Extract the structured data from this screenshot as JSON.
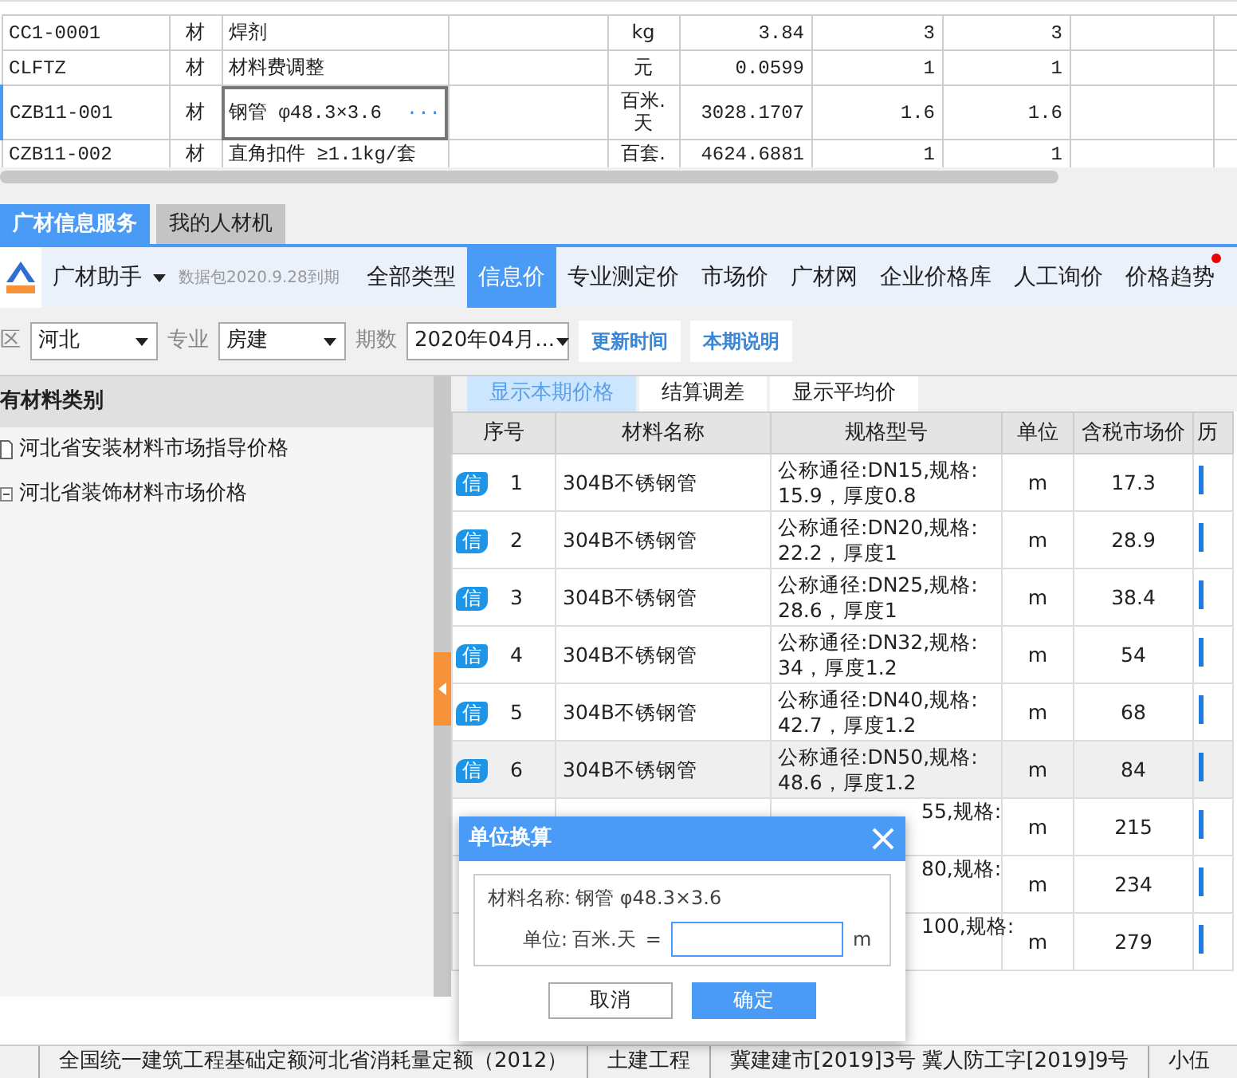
{
  "top_grid": {
    "rows": [
      {
        "code": "CC1-0001",
        "type": "材",
        "name": "焊剂",
        "unit": "kg",
        "price": "3.84",
        "qty_1": "3",
        "qty_2": "3",
        "selected": false
      },
      {
        "code": "CLFTZ",
        "type": "材",
        "name": "材料费调整",
        "unit": "元",
        "price": "0.0599",
        "qty_1": "1",
        "qty_2": "1",
        "selected": false
      },
      {
        "code": "CZB11-001",
        "type": "材",
        "name": "钢管 φ48.3×3.6",
        "unit": "百米.天",
        "price": "3028.1707",
        "qty_1": "1.6",
        "qty_2": "1.6",
        "selected": true,
        "more": "···"
      },
      {
        "code": "CZB11-002",
        "type": "材",
        "name": "直角扣件 ≥1.1kg/套",
        "unit": "百套.",
        "price": "4624.6881",
        "qty_1": "1",
        "qty_2": "1",
        "selected": false
      }
    ]
  },
  "panel_tabs": [
    {
      "label": "广材信息服务",
      "selected": true
    },
    {
      "label": "我的人材机",
      "selected": false
    }
  ],
  "toolbar": {
    "brand": "广材助手",
    "expiry": "数据包2020.9.28到期",
    "nav": [
      {
        "label": "全部类型",
        "selected": false,
        "notification": false
      },
      {
        "label": "信息价",
        "selected": true,
        "notification": false
      },
      {
        "label": "专业测定价",
        "selected": false,
        "notification": false
      },
      {
        "label": "市场价",
        "selected": false,
        "notification": false
      },
      {
        "label": "广材网",
        "selected": false,
        "notification": false
      },
      {
        "label": "企业价格库",
        "selected": false,
        "notification": false
      },
      {
        "label": "人工询价",
        "selected": false,
        "notification": false
      },
      {
        "label": "价格趋势",
        "selected": false,
        "notification": true
      }
    ]
  },
  "filters": {
    "region_label": "区",
    "region": "河北",
    "specialty_label": "专业",
    "specialty": "房建",
    "period_label": "期数",
    "period": "2020年04月...",
    "buttons": [
      "更新时间",
      "本期说明"
    ]
  },
  "category_panel": {
    "title": "有材料类别",
    "items": [
      {
        "label": "河北省安装材料市场指导价格",
        "kind": "file"
      },
      {
        "label": "河北省装饰材料市场价格",
        "kind": "expandable"
      }
    ]
  },
  "view_tabs": [
    {
      "label": "显示本期价格",
      "selected": true
    },
    {
      "label": "结算调差",
      "selected": false
    },
    {
      "label": "显示平均价",
      "selected": false
    }
  ],
  "price_table": {
    "columns": [
      "序号",
      "材料名称",
      "规格型号",
      "单位",
      "含税市场价",
      "历"
    ],
    "rows": [
      {
        "kind": "full",
        "badge": "信",
        "seq": "1",
        "name": "304B不锈钢管",
        "spec_lines": [
          "公称通径:DN15,规格:",
          "15.9，厚度0.8"
        ],
        "unit": "m",
        "price": "17.3",
        "selected": false
      },
      {
        "kind": "full",
        "badge": "信",
        "seq": "2",
        "name": "304B不锈钢管",
        "spec_lines": [
          "公称通径:DN20,规格:",
          "22.2，厚度1"
        ],
        "unit": "m",
        "price": "28.9",
        "selected": false
      },
      {
        "kind": "full",
        "badge": "信",
        "seq": "3",
        "name": "304B不锈钢管",
        "spec_lines": [
          "公称通径:DN25,规格:",
          "28.6，厚度1"
        ],
        "unit": "m",
        "price": "38.4",
        "selected": false
      },
      {
        "kind": "full",
        "badge": "信",
        "seq": "4",
        "name": "304B不锈钢管",
        "spec_lines": [
          "公称通径:DN32,规格:",
          "34，厚度1.2"
        ],
        "unit": "m",
        "price": "54",
        "selected": false
      },
      {
        "kind": "full",
        "badge": "信",
        "seq": "5",
        "name": "304B不锈钢管",
        "spec_lines": [
          "公称通径:DN40,规格:",
          "42.7，厚度1.2"
        ],
        "unit": "m",
        "price": "68",
        "selected": false
      },
      {
        "kind": "full",
        "badge": "信",
        "seq": "6",
        "name": "304B不锈钢管",
        "spec_lines": [
          "公称通径:DN50,规格:",
          "48.6，厚度1.2"
        ],
        "unit": "m",
        "price": "84",
        "selected": true
      },
      {
        "kind": "covered",
        "spec_lines": [
          "55,规格:"
        ],
        "unit": "m",
        "price": "215",
        "selected": false
      },
      {
        "kind": "covered",
        "spec_lines": [
          "80,规格:"
        ],
        "unit": "m",
        "price": "234",
        "selected": false
      },
      {
        "kind": "covered",
        "spec_lines": [
          "100,规格:"
        ],
        "unit": "m",
        "price": "279",
        "selected": false
      }
    ]
  },
  "dialog": {
    "title": "单位换算",
    "material_label": "材料名称:",
    "material": "钢管 φ48.3×3.6",
    "unit_label": "单位:",
    "unit_from": "百米.天",
    "equals": "=",
    "unit_to": "m",
    "buttons": [
      {
        "label": "取消",
        "kind": "secondary"
      },
      {
        "label": "确定",
        "kind": "primary"
      }
    ]
  },
  "status_bar": [
    "全国统一建筑工程基础定额河北省消耗量定额（2012）",
    "土建工程",
    "冀建建市[2019]3号  冀人防工字[2019]9号",
    "小伍"
  ]
}
